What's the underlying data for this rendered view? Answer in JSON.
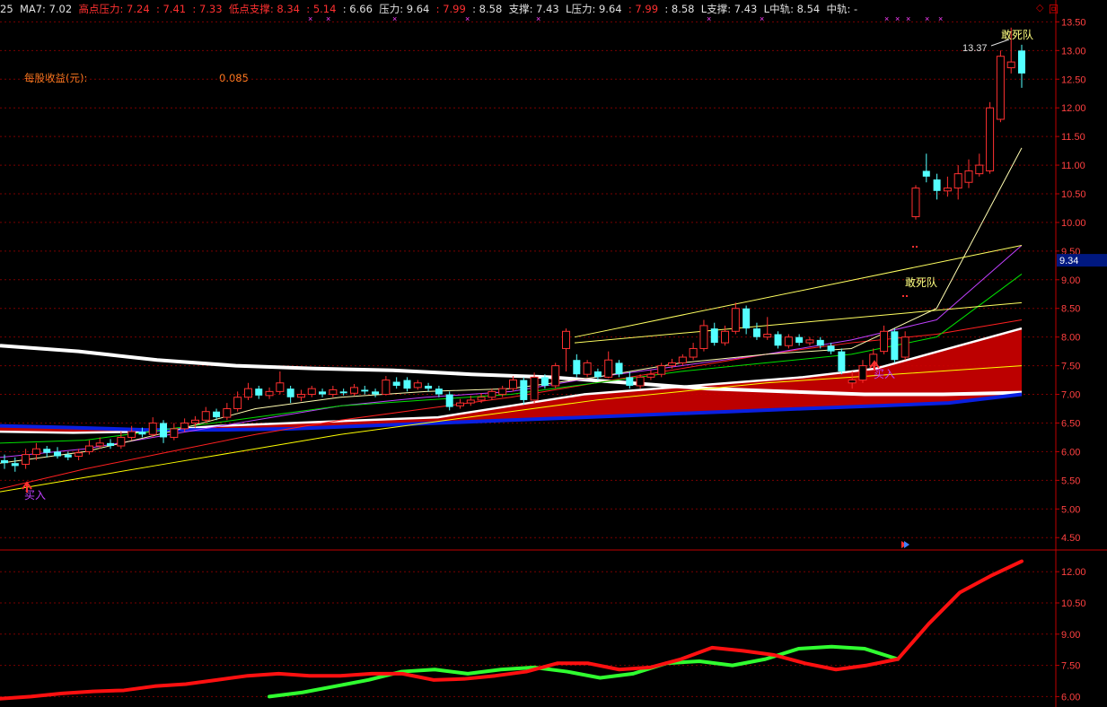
{
  "header": [
    {
      "text": "25",
      "color": "#e0e0e0"
    },
    {
      "text": "  MA7: 7.02  ",
      "color": "#e0e0e0"
    },
    {
      "text": "高点压力: 7.24  : 7.41  : 7.33  ",
      "color": "#ff3030"
    },
    {
      "text": "低点支撑: 8.34  : 5.14  ",
      "color": "#ff3030"
    },
    {
      "text": ": 6.66  ",
      "color": "#e0e0e0"
    },
    {
      "text": "压力: 9.64  ",
      "color": "#e0e0e0"
    },
    {
      "text": ": 7.99  ",
      "color": "#ff3030"
    },
    {
      "text": ": 8.58  ",
      "color": "#e0e0e0"
    },
    {
      "text": "支撑: 7.43  ",
      "color": "#e0e0e0"
    },
    {
      "text": "L压力: 9.64  ",
      "color": "#e0e0e0"
    },
    {
      "text": ": 7.99  ",
      "color": "#ff3030"
    },
    {
      "text": ": 8.58  ",
      "color": "#e0e0e0"
    },
    {
      "text": "L支撑: 7.43  ",
      "color": "#e0e0e0"
    },
    {
      "text": "L中轨: 8.54  ",
      "color": "#e0e0e0"
    },
    {
      "text": "中轨: -",
      "color": "#e0e0e0"
    }
  ],
  "window_controls": [
    "◇",
    "回"
  ],
  "info_label": "每股收益(元):",
  "info_value": "0.085",
  "price_marker": "9.34",
  "high_label": "13.37",
  "colors": {
    "up": "#ff3030",
    "down": "#54ffff",
    "grid": "#7a0000",
    "axis": "#c00000"
  },
  "chart_data": [
    {
      "type": "candlestick",
      "y_axis": {
        "min": 4.3,
        "max": 13.6,
        "ticks": [
          "4.50",
          "5.00",
          "5.50",
          "6.00",
          "6.50",
          "7.00",
          "7.50",
          "8.00",
          "8.50",
          "9.00",
          "9.50",
          "10.00",
          "10.50",
          "11.00",
          "11.50",
          "12.00",
          "12.50",
          "13.00",
          "13.50"
        ]
      },
      "grid": true,
      "candles": [
        [
          5.85,
          5.8,
          5.95,
          5.7
        ],
        [
          5.8,
          5.75,
          5.9,
          5.65
        ],
        [
          5.78,
          5.95,
          6.05,
          5.7
        ],
        [
          5.95,
          6.05,
          6.15,
          5.85
        ],
        [
          6.05,
          5.98,
          6.1,
          5.9
        ],
        [
          6.0,
          5.92,
          6.08,
          5.88
        ],
        [
          5.95,
          5.9,
          6.0,
          5.85
        ],
        [
          5.92,
          5.98,
          6.05,
          5.85
        ],
        [
          6.0,
          6.1,
          6.2,
          5.95
        ],
        [
          6.1,
          6.15,
          6.25,
          6.05
        ],
        [
          6.15,
          6.1,
          6.22,
          6.05
        ],
        [
          6.1,
          6.25,
          6.35,
          6.05
        ],
        [
          6.25,
          6.35,
          6.45,
          6.2
        ],
        [
          6.35,
          6.3,
          6.42,
          6.25
        ],
        [
          6.3,
          6.5,
          6.6,
          6.25
        ],
        [
          6.5,
          6.25,
          6.55,
          6.15
        ],
        [
          6.25,
          6.4,
          6.5,
          6.2
        ],
        [
          6.4,
          6.5,
          6.58,
          6.35
        ],
        [
          6.5,
          6.55,
          6.62,
          6.42
        ],
        [
          6.55,
          6.7,
          6.78,
          6.5
        ],
        [
          6.7,
          6.6,
          6.75,
          6.55
        ],
        [
          6.6,
          6.75,
          6.85,
          6.55
        ],
        [
          6.75,
          6.95,
          7.05,
          6.7
        ],
        [
          6.95,
          7.1,
          7.2,
          6.9
        ],
        [
          7.1,
          6.98,
          7.15,
          6.92
        ],
        [
          6.98,
          7.05,
          7.12,
          6.92
        ],
        [
          7.05,
          7.2,
          7.4,
          7.0
        ],
        [
          7.1,
          6.95,
          7.15,
          6.85
        ],
        [
          6.95,
          7.0,
          7.08,
          6.88
        ],
        [
          7.0,
          7.1,
          7.15,
          6.95
        ],
        [
          7.05,
          7.0,
          7.1,
          6.95
        ],
        [
          7.0,
          7.08,
          7.15,
          6.95
        ],
        [
          7.05,
          7.02,
          7.1,
          6.98
        ],
        [
          7.02,
          7.12,
          7.18,
          6.98
        ],
        [
          7.08,
          7.05,
          7.15,
          7.0
        ],
        [
          7.05,
          7.0,
          7.1,
          6.95
        ],
        [
          7.0,
          7.25,
          7.32,
          6.98
        ],
        [
          7.22,
          7.15,
          7.3,
          7.1
        ],
        [
          7.25,
          7.1,
          7.3,
          7.05
        ],
        [
          7.12,
          7.2,
          7.25,
          7.08
        ],
        [
          7.15,
          7.1,
          7.2,
          7.05
        ],
        [
          7.1,
          7.0,
          7.15,
          6.95
        ],
        [
          7.0,
          6.78,
          7.05,
          6.72
        ],
        [
          6.8,
          6.85,
          6.92,
          6.75
        ],
        [
          6.85,
          6.9,
          6.98,
          6.8
        ],
        [
          6.9,
          6.95,
          7.02,
          6.85
        ],
        [
          6.95,
          7.05,
          7.1,
          6.9
        ],
        [
          7.0,
          7.1,
          7.15,
          6.95
        ],
        [
          7.1,
          7.25,
          7.32,
          7.05
        ],
        [
          7.25,
          6.9,
          7.3,
          6.82
        ],
        [
          6.9,
          7.3,
          7.38,
          6.85
        ],
        [
          7.3,
          7.15,
          7.35,
          7.1
        ],
        [
          7.15,
          7.5,
          7.55,
          7.1
        ],
        [
          7.8,
          8.1,
          8.15,
          7.4
        ],
        [
          7.6,
          7.35,
          7.7,
          7.3
        ],
        [
          7.35,
          7.55,
          7.6,
          7.3
        ],
        [
          7.4,
          7.3,
          7.45,
          7.25
        ],
        [
          7.3,
          7.6,
          7.75,
          7.28
        ],
        [
          7.55,
          7.35,
          7.6,
          7.3
        ],
        [
          7.3,
          7.15,
          7.4,
          7.1
        ],
        [
          7.15,
          7.3,
          7.35,
          7.1
        ],
        [
          7.3,
          7.35,
          7.42,
          7.25
        ],
        [
          7.35,
          7.5,
          7.55,
          7.3
        ],
        [
          7.5,
          7.55,
          7.62,
          7.45
        ],
        [
          7.55,
          7.65,
          7.7,
          7.5
        ],
        [
          7.65,
          7.8,
          7.9,
          7.6
        ],
        [
          7.8,
          8.2,
          8.3,
          7.75
        ],
        [
          8.15,
          7.9,
          8.25,
          7.85
        ],
        [
          7.9,
          8.1,
          8.2,
          7.85
        ],
        [
          8.1,
          8.5,
          8.6,
          8.05
        ],
        [
          8.5,
          8.15,
          8.55,
          8.05
        ],
        [
          8.15,
          8.0,
          8.25,
          7.95
        ],
        [
          8.0,
          8.05,
          8.35,
          7.95
        ],
        [
          8.05,
          7.85,
          8.1,
          7.8
        ],
        [
          7.85,
          8.0,
          8.05,
          7.8
        ],
        [
          8.0,
          7.9,
          8.05,
          7.85
        ],
        [
          7.9,
          7.95,
          8.0,
          7.85
        ],
        [
          7.95,
          7.85,
          8.0,
          7.8
        ],
        [
          7.85,
          7.75,
          7.9,
          7.7
        ],
        [
          7.75,
          7.4,
          7.8,
          7.35
        ],
        [
          7.2,
          7.25,
          7.4,
          7.1
        ],
        [
          7.25,
          7.5,
          7.6,
          7.2
        ],
        [
          7.5,
          7.7,
          7.8,
          7.45
        ],
        [
          7.75,
          8.1,
          8.2,
          7.7
        ],
        [
          8.1,
          7.6,
          8.15,
          7.55
        ],
        [
          7.65,
          8.0,
          8.1,
          7.6
        ],
        [
          10.1,
          10.6,
          10.65,
          10.05
        ],
        [
          10.9,
          10.8,
          11.2,
          10.7
        ],
        [
          10.75,
          10.55,
          10.85,
          10.4
        ],
        [
          10.55,
          10.6,
          10.8,
          10.45
        ],
        [
          10.6,
          10.85,
          11.0,
          10.4
        ],
        [
          10.7,
          10.9,
          11.1,
          10.6
        ],
        [
          10.85,
          11.0,
          11.2,
          10.8
        ],
        [
          10.9,
          12.0,
          12.1,
          10.85
        ],
        [
          11.8,
          12.9,
          13.0,
          11.75
        ],
        [
          12.7,
          12.8,
          13.4,
          12.6
        ],
        [
          13.0,
          12.6,
          13.1,
          12.35
        ]
      ],
      "series": [
        {
          "color": "#ffffff",
          "width": 4,
          "values": [
            7.85,
            7.75,
            7.6,
            7.5,
            7.45,
            7.42,
            7.35,
            7.3,
            7.2,
            7.1,
            7.05,
            7.0,
            7.0,
            7.03
          ]
        },
        {
          "color": "#ffffff",
          "width": 2.5,
          "values": [
            6.35,
            6.33,
            6.35,
            6.45,
            6.5,
            6.55,
            6.6,
            6.8,
            7.0,
            7.1,
            7.2,
            7.3,
            7.45,
            7.8,
            8.15
          ]
        },
        {
          "color": "#0a20e0",
          "width": 4,
          "values": [
            6.45,
            6.42,
            6.38,
            6.38,
            6.4,
            6.45,
            6.5,
            6.55,
            6.6,
            6.65,
            6.7,
            6.75,
            6.8,
            6.85,
            7.0
          ]
        },
        {
          "color": "#ff2020",
          "width": 1,
          "values": [
            5.35,
            5.7,
            6.0,
            6.3,
            6.55,
            6.75,
            6.95,
            7.2,
            7.45,
            7.7,
            7.9,
            8.05,
            8.3
          ]
        },
        {
          "color": "#ffff00",
          "width": 1,
          "values": [
            5.3,
            5.55,
            5.8,
            6.05,
            6.3,
            6.5,
            6.7,
            6.9,
            7.05,
            7.2,
            7.3,
            7.4,
            7.5
          ]
        },
        {
          "color": "#c040ff",
          "width": 1,
          "values": [
            5.9,
            6.05,
            6.3,
            6.55,
            6.8,
            6.95,
            7.05,
            7.3,
            7.5,
            7.7,
            7.95,
            8.3,
            9.6
          ]
        },
        {
          "color": "#00e000",
          "width": 1,
          "values": [
            6.15,
            6.2,
            6.4,
            6.6,
            6.8,
            6.9,
            7.0,
            7.2,
            7.4,
            7.55,
            7.7,
            8.0,
            9.1
          ]
        },
        {
          "color": "#fffcb0",
          "width": 1,
          "values": [
            5.8,
            6.0,
            6.35,
            6.75,
            6.95,
            7.05,
            7.1,
            7.3,
            7.55,
            7.7,
            7.8,
            8.5,
            11.3
          ]
        },
        {
          "color": "#ffff60",
          "width": 1,
          "values": [
            8.0,
            9.6
          ]
        },
        {
          "color": "#ffff60",
          "width": 1,
          "values": [
            7.9,
            8.6
          ]
        }
      ],
      "annotations": [
        {
          "text": "买入",
          "color": "#c040ff"
        },
        {
          "text": "买入",
          "color": "#c040ff"
        },
        {
          "text": "敢死队",
          "color": "#ffff80"
        },
        {
          "text": "敢死队",
          "color": "#ffff80"
        }
      ]
    },
    {
      "type": "line",
      "y_axis": {
        "min": 5.5,
        "max": 13.0,
        "ticks": [
          "6.00",
          "7.50",
          "9.00",
          "10.50",
          "12.00"
        ]
      },
      "grid": true,
      "series": [
        {
          "color": "#30ff30",
          "width": 4,
          "values": [
            6.0,
            6.2,
            6.5,
            6.8,
            7.2,
            7.3,
            7.1,
            7.3,
            7.4,
            7.2,
            6.9,
            7.1,
            7.6,
            7.7,
            7.5,
            7.8,
            8.3,
            8.4,
            8.3,
            7.8
          ]
        },
        {
          "color": "#ff1010",
          "width": 4,
          "values": [
            5.9,
            6.0,
            6.15,
            6.25,
            6.3,
            6.5,
            6.6,
            6.8,
            7.0,
            7.1,
            7.0,
            7.0,
            7.1,
            7.1,
            6.8,
            6.85,
            7.0,
            7.2,
            7.6,
            7.6,
            7.3,
            7.4,
            7.8,
            8.35,
            8.2,
            8.0,
            7.6,
            7.3,
            7.5,
            7.8,
            9.5,
            11.0,
            11.8,
            12.5
          ]
        }
      ]
    }
  ]
}
